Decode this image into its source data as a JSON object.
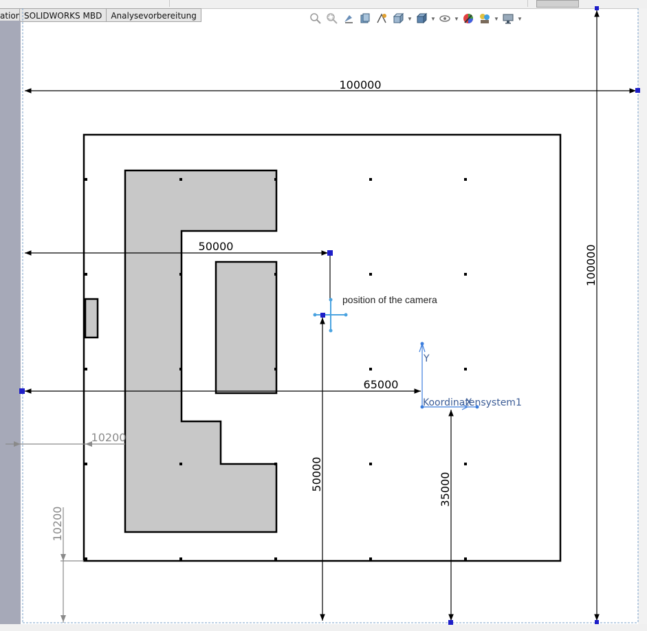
{
  "tabs": [
    {
      "label": "ation"
    },
    {
      "label": "SOLIDWORKS MBD"
    },
    {
      "label": "Analysevorbereitung"
    }
  ],
  "toolbar_icons": [
    "zoom-to-fit-icon",
    "zoom-to-area-icon",
    "previous-view-icon",
    "section-view-icon",
    "dynamic-annotation-icon",
    "view-orientation-icon",
    "display-style-icon",
    "hide-show-items-icon",
    "edit-appearance-icon",
    "apply-scene-icon",
    "view-settings-icon"
  ],
  "dimensions": {
    "top_width": "100000",
    "right_height": "100000",
    "camera_x": "50000",
    "camera_y": "50000",
    "csys_x": "65000",
    "csys_y": "35000",
    "left_offset": "10200",
    "bottom_offset": "10200"
  },
  "camera_note": "position of the camera",
  "coordinate_system_label": "Koordinatensystem1",
  "axis_label_y": "Y",
  "axis_label_x": "X",
  "colors": {
    "sketch_line": "#000000",
    "fill_gray": "#c8c8c8",
    "selected_point": "#1e1ec8",
    "camera_marker": "#4aa3e0",
    "csys_color": "#3b7ddd",
    "left_strip": "#a6a9b8"
  }
}
